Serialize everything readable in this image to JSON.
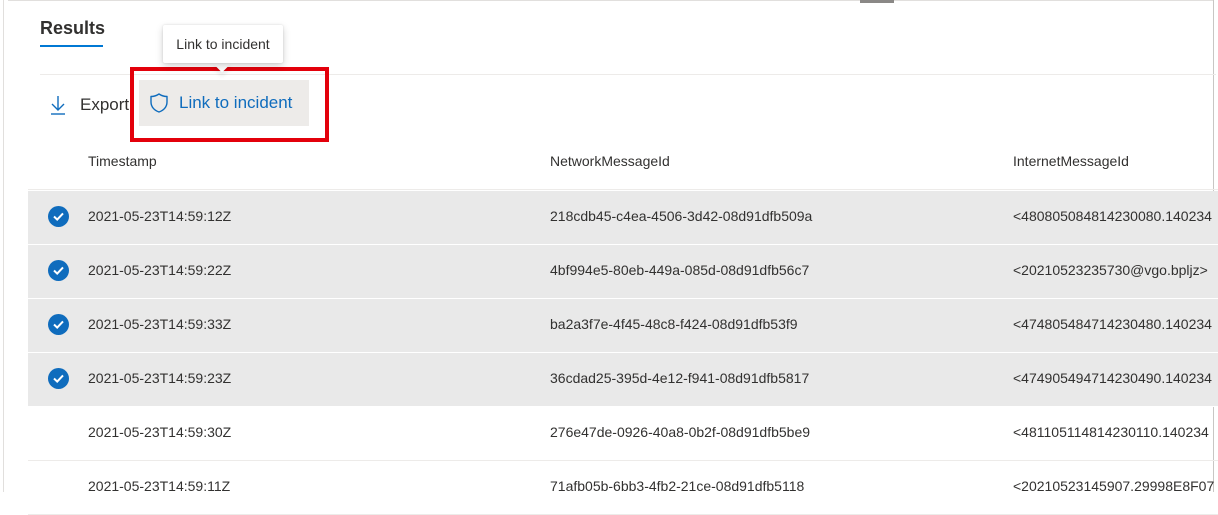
{
  "results_tab": "Results",
  "tooltip": "Link to incident",
  "toolbar": {
    "export_label": "Export",
    "link_label": "Link to incident",
    "export_icon": "download-icon",
    "link_icon": "shield-icon"
  },
  "columns": [
    "Timestamp",
    "NetworkMessageId",
    "InternetMessageId"
  ],
  "rows": [
    {
      "selected": true,
      "timestamp": "2021-05-23T14:59:12Z",
      "network": "218cdb45-c4ea-4506-3d42-08d91dfb509a",
      "internet": "<480805084814230080.140234"
    },
    {
      "selected": true,
      "timestamp": "2021-05-23T14:59:22Z",
      "network": "4bf994e5-80eb-449a-085d-08d91dfb56c7",
      "internet": "<20210523235730@vgo.bpljz>"
    },
    {
      "selected": true,
      "timestamp": "2021-05-23T14:59:33Z",
      "network": "ba2a3f7e-4f45-48c8-f424-08d91dfb53f9",
      "internet": "<474805484714230480.140234"
    },
    {
      "selected": true,
      "timestamp": "2021-05-23T14:59:23Z",
      "network": "36cdad25-395d-4e12-f941-08d91dfb5817",
      "internet": "<474905494714230490.140234"
    },
    {
      "selected": false,
      "timestamp": "2021-05-23T14:59:30Z",
      "network": "276e47de-0926-40a8-0b2f-08d91dfb5be9",
      "internet": "<481105114814230110.140234"
    },
    {
      "selected": false,
      "timestamp": "2021-05-23T14:59:11Z",
      "network": "71afb05b-6bb3-4fb2-21ce-08d91dfb5118",
      "internet": "<20210523145907.29998E8F07"
    }
  ],
  "colors": {
    "accent": "#0f6cbd",
    "highlight": "#e3000b",
    "selected_row": "#e9e9e9"
  }
}
